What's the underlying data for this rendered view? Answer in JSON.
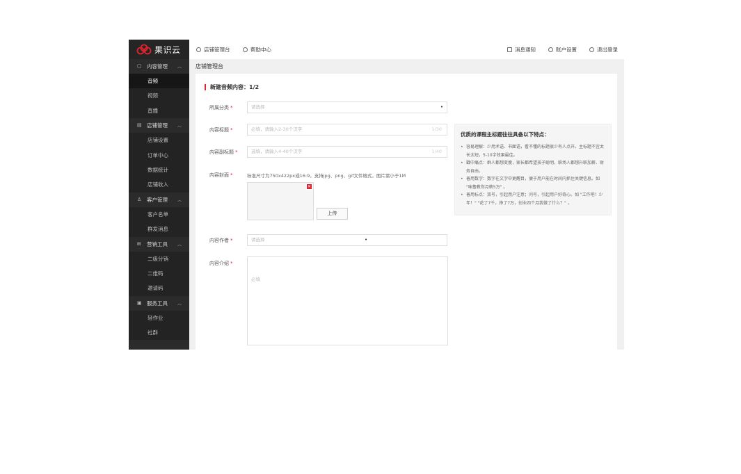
{
  "brand": {
    "name": "果识云"
  },
  "sidebar": {
    "groups": [
      {
        "label": "内容管理",
        "icon": "content-icon",
        "items": [
          "音频",
          "视频",
          "直播"
        ]
      },
      {
        "label": "店铺管理",
        "icon": "store-icon",
        "items": [
          "店铺设置",
          "订单中心",
          "数据统计",
          "店铺收入"
        ]
      },
      {
        "label": "客户管理",
        "icon": "customer-icon",
        "items": [
          "客户名单",
          "群发消息"
        ]
      },
      {
        "label": "营销工具",
        "icon": "marketing-icon",
        "items": [
          "二级分销",
          "二维码",
          "邀请码"
        ]
      },
      {
        "label": "服务工具",
        "icon": "service-icon",
        "items": [
          "轻作业",
          "社群"
        ]
      }
    ],
    "active_item": "音频"
  },
  "topbar": {
    "left": [
      {
        "label": "店铺管理台",
        "icon": "gear-icon"
      },
      {
        "label": "帮助中心",
        "icon": "help-icon"
      }
    ],
    "right": [
      {
        "label": "消息通知",
        "icon": "message-icon"
      },
      {
        "label": "账户设置",
        "icon": "settings-icon"
      },
      {
        "label": "退出登录",
        "icon": "power-icon"
      }
    ]
  },
  "breadcrumb": "店铺管理台",
  "form": {
    "section_title": "新建音频内容：1/2",
    "category": {
      "label": "所属分类",
      "required": "*",
      "placeholder": "请选择"
    },
    "title": {
      "label": "内容标题",
      "required": "*",
      "placeholder": "必填，请输入2-30个汉字",
      "counter": "1/30"
    },
    "subtitle": {
      "label": "内容副标题",
      "required": "*",
      "placeholder": "选填，请输入4-40个汉字",
      "counter": "1/40"
    },
    "cover": {
      "label": "内容封面",
      "required": "*",
      "hint": "标准尺寸为750x422px或16:9，支持jpg、png、gif文件格式，图片需小于1M",
      "upload_button": "上传"
    },
    "author": {
      "label": "内容作者",
      "required": "*",
      "placeholder": "请选择"
    },
    "intro": {
      "label": "内容介绍",
      "required": "*",
      "placeholder": "必填"
    }
  },
  "tips": {
    "title": "优质的课程主标题往往具备以下特点：",
    "items": [
      "容易理解：少用术语、书面语，看不懂的标题很少有人点开。主标题不宜太长太短，5-10字效果最佳。",
      "戳中痛点：群人都想变瘦，家长都希望孩子聪明，职场人都想升职加薪、财务自由。",
      "善用数字：数字在文字中更醒目，便于用户能在时间内抓住关键信息。如 \"味蕾教你月薪5万\" 。",
      "善用标点：双号，引起用户注意；问号，引起用户好奇心。如 \"工作吧！少年！\" \"花了7千，挣了7万，创业四个月我做了什么？\" 。"
    ]
  },
  "colors": {
    "accent": "#e0232f",
    "sidebar_bg": "#2b2b2b"
  }
}
